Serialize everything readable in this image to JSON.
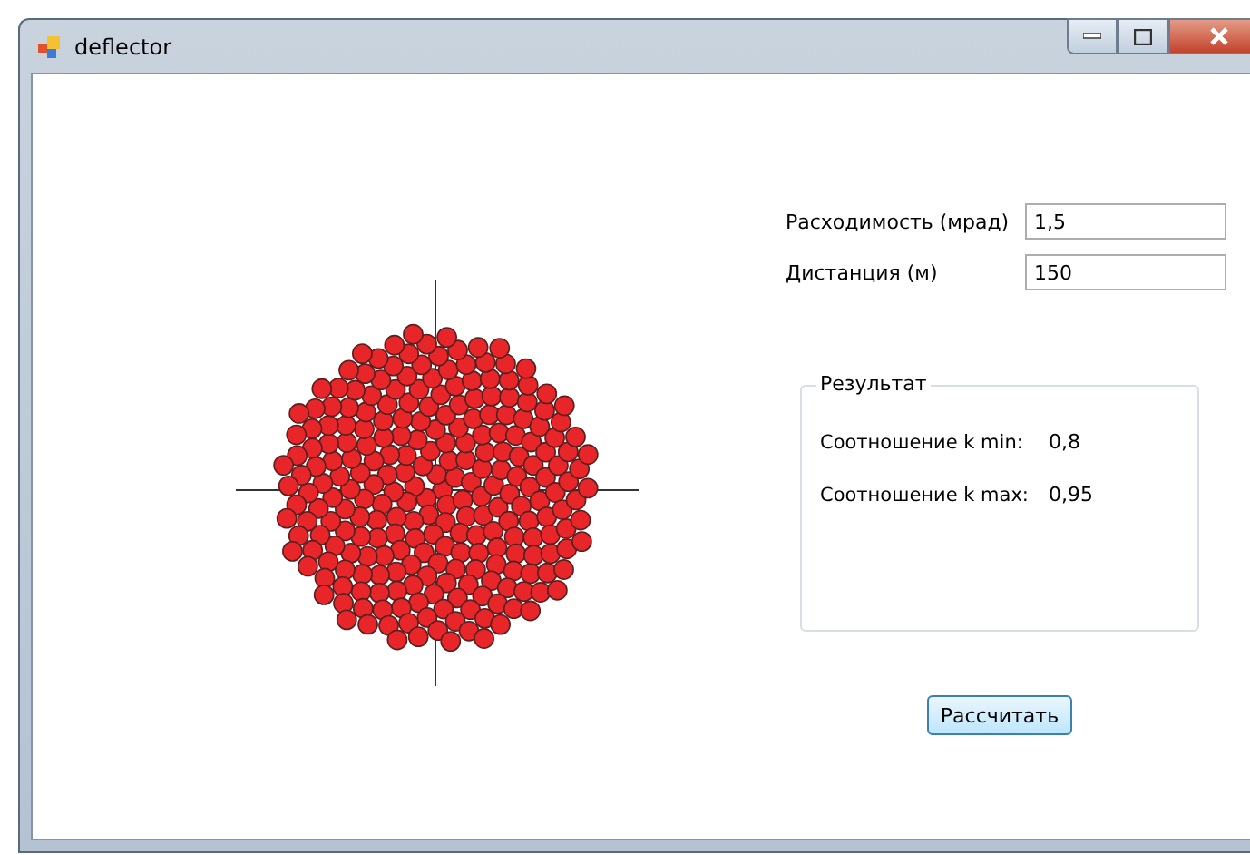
{
  "window": {
    "title": "deflector"
  },
  "fields": [
    {
      "label": "Расходимость (мрад)",
      "value": "1,5"
    },
    {
      "label": "Дистанция (м)",
      "value": "150"
    }
  ],
  "result_group": {
    "title": "Результат",
    "rows": [
      {
        "label": "Соотношение k min:",
        "value": "0,8"
      },
      {
        "label": "Соотношение k max:",
        "value": "0,95"
      }
    ]
  },
  "calculate_button": "Рассчитать"
}
